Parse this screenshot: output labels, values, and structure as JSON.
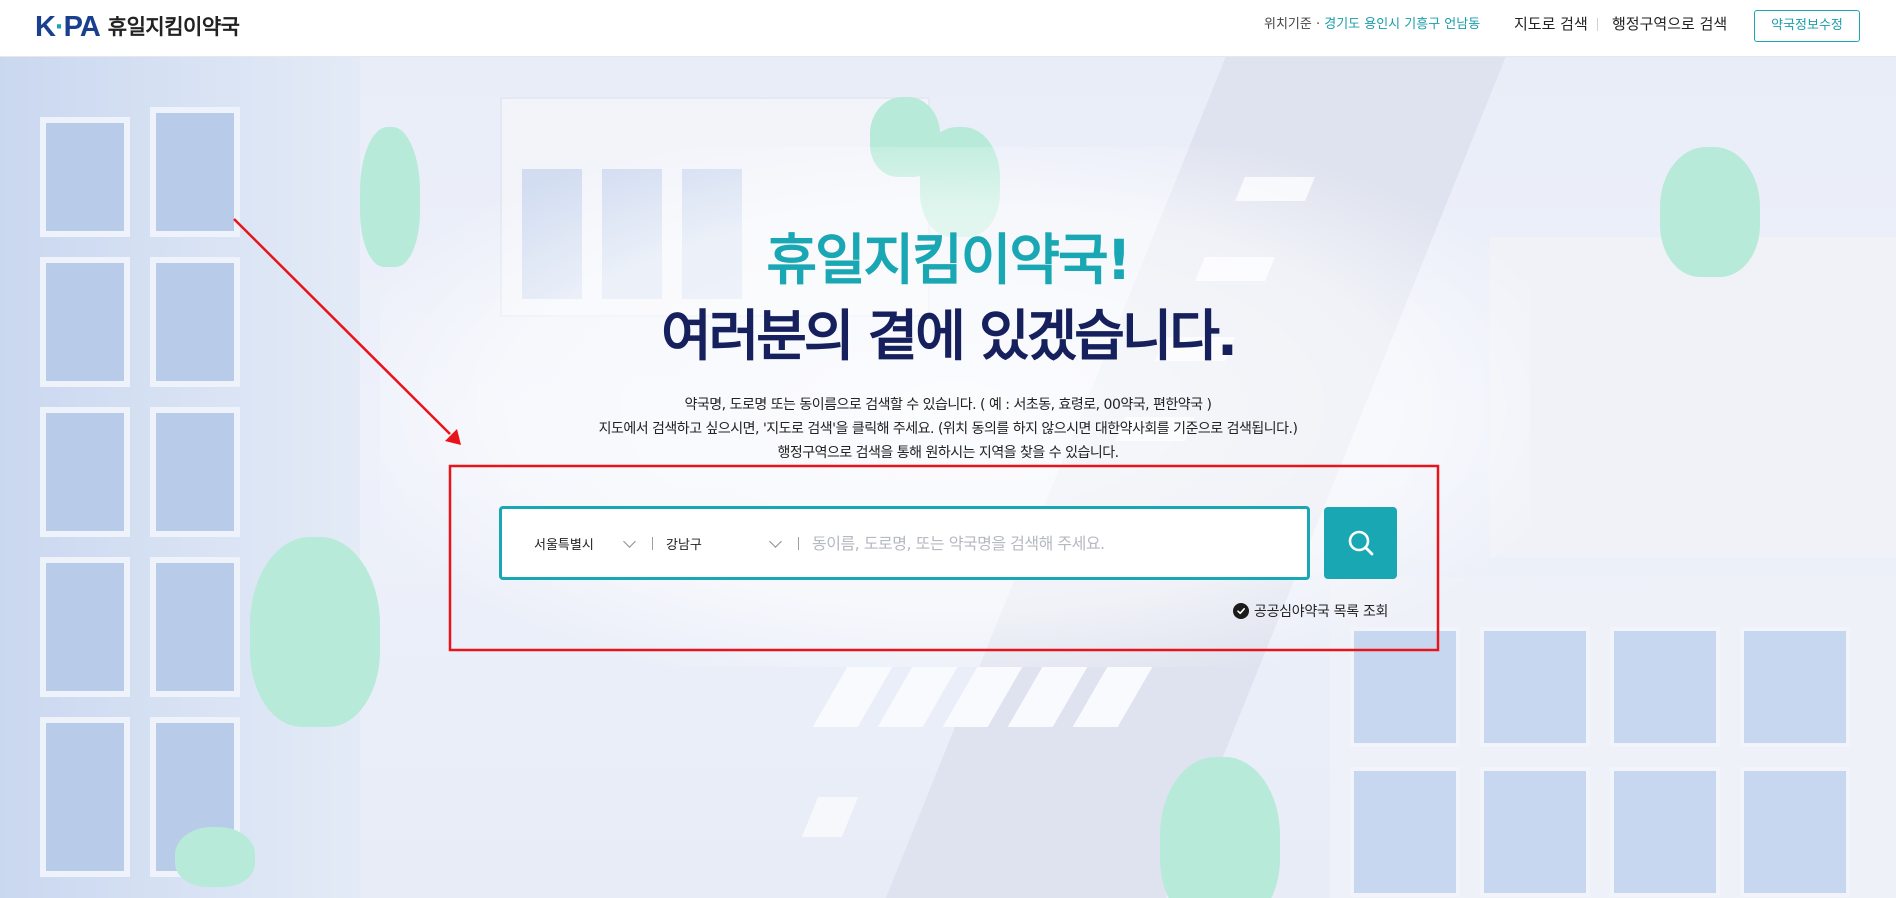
{
  "header": {
    "logo_mark": "K",
    "logo_mark_dot": "·",
    "logo_mark_tail": "PA",
    "logo_text": "휴일지킴이약국",
    "location_label": "위치기준 · ",
    "location_value": "경기도 용인시 기흥구 언남동",
    "nav_map": "지도로 검색",
    "nav_admin": "행정구역으로 검색",
    "edit_button": "약국정보수정"
  },
  "hero": {
    "title_line1": "휴일지킴이약국!",
    "title_line2": "여러분의 곁에 있겠습니다.",
    "desc_line1": "약국명, 도로명 또는 동이름으로 검색할 수 있습니다. ( 예 : 서초동, 효령로, 00약국, 편한약국 )",
    "desc_line2": "지도에서 검색하고 싶으시면, '지도로 검색'을 클릭해 주세요. (위치 동의를 하지 않으시면 대한약사회를 기준으로 검색됩니다.)",
    "desc_line3": "행정구역으로 검색을 통해 원하시는 지역을 찾을 수 있습니다."
  },
  "search": {
    "city_selected": "서울특별시",
    "gu_selected": "강남구",
    "input_value": "",
    "input_placeholder": "동이름, 도로명, 또는 약국명을 검색해 주세요.",
    "button_icon": "search-icon",
    "public_link": "공공심야약국 목록 조회"
  },
  "colors": {
    "accent": "#1aa7b4",
    "title_dark": "#15205c",
    "annotation": "#e8141a"
  }
}
